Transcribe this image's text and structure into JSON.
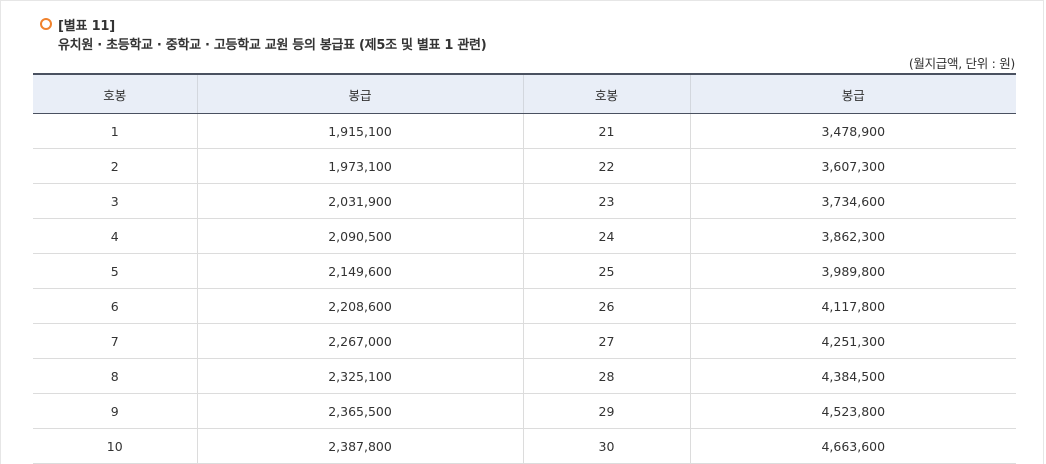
{
  "heading": {
    "label": "[별표 11]",
    "title": "유치원 · 초등학교 · 중학교 · 고등학교 교원 등의 봉급표 (제5조 및 별표 1 관련)"
  },
  "unit_note": "(월지급액, 단위 : 원)",
  "table": {
    "headers": [
      "호봉",
      "봉급",
      "호봉",
      "봉급"
    ],
    "rows": [
      [
        "1",
        "1,915,100",
        "21",
        "3,478,900"
      ],
      [
        "2",
        "1,973,100",
        "22",
        "3,607,300"
      ],
      [
        "3",
        "2,031,900",
        "23",
        "3,734,600"
      ],
      [
        "4",
        "2,090,500",
        "24",
        "3,862,300"
      ],
      [
        "5",
        "2,149,600",
        "25",
        "3,989,800"
      ],
      [
        "6",
        "2,208,600",
        "26",
        "4,117,800"
      ],
      [
        "7",
        "2,267,000",
        "27",
        "4,251,300"
      ],
      [
        "8",
        "2,325,100",
        "28",
        "4,384,500"
      ],
      [
        "9",
        "2,365,500",
        "29",
        "4,523,800"
      ],
      [
        "10",
        "2,387,800",
        "30",
        "4,663,600"
      ]
    ]
  },
  "colors": {
    "accent": "#f0822d",
    "header_bg": "#e9eef7",
    "header_rule": "#4a5160"
  }
}
